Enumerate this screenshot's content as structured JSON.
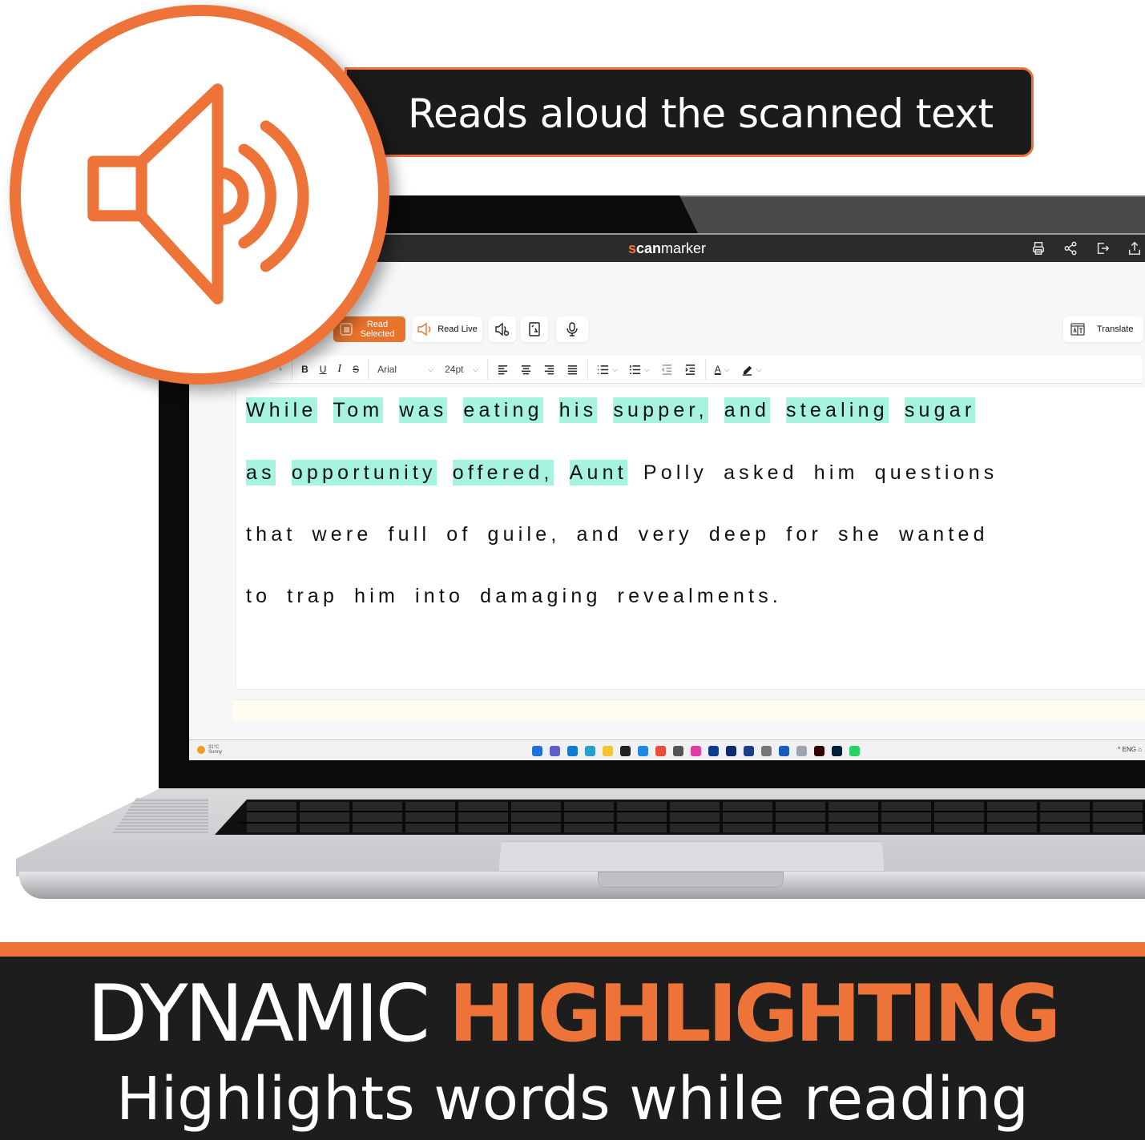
{
  "banner": {
    "text": "Reads aloud the scanned text"
  },
  "app": {
    "brand_s": "s",
    "brand_can": "can",
    "brand_rest": "marker",
    "title_icons": [
      "printer-icon",
      "share-icon",
      "export-icon",
      "upload-icon"
    ]
  },
  "toolbar": {
    "read_selected_line1": "Read",
    "read_selected_line2": "Selected",
    "read_live": "Read Live",
    "translate": "Translate"
  },
  "format_bar": {
    "font": "Arial",
    "size": "24pt",
    "buttons": [
      "bold",
      "underline",
      "italic",
      "strikethrough",
      "align-left",
      "align-center",
      "align-right",
      "justify",
      "bullet-list",
      "numbered-list",
      "outdent",
      "indent",
      "text-color",
      "highlight-color"
    ]
  },
  "document": {
    "lines": [
      [
        {
          "text": "While",
          "highlighted": true
        },
        {
          "text": "Tom",
          "highlighted": true
        },
        {
          "text": "was",
          "highlighted": true
        },
        {
          "text": "eating",
          "highlighted": true
        },
        {
          "text": "his",
          "highlighted": true
        },
        {
          "text": "supper,",
          "highlighted": true
        },
        {
          "text": "and",
          "highlighted": true
        },
        {
          "text": "stealing",
          "highlighted": true
        },
        {
          "text": "sugar",
          "highlighted": true
        }
      ],
      [
        {
          "text": "as",
          "highlighted": true
        },
        {
          "text": "opportunity",
          "highlighted": true
        },
        {
          "text": "offered,",
          "highlighted": true
        },
        {
          "text": "Aunt",
          "highlighted": true
        },
        {
          "text": "Polly",
          "highlighted": false
        },
        {
          "text": "asked",
          "highlighted": false
        },
        {
          "text": "him",
          "highlighted": false
        },
        {
          "text": "questions",
          "highlighted": false
        }
      ],
      [
        {
          "text": "that",
          "highlighted": false
        },
        {
          "text": "were",
          "highlighted": false
        },
        {
          "text": "full",
          "highlighted": false
        },
        {
          "text": "of",
          "highlighted": false
        },
        {
          "text": "guile,",
          "highlighted": false
        },
        {
          "text": "and",
          "highlighted": false
        },
        {
          "text": "very",
          "highlighted": false
        },
        {
          "text": "deep",
          "highlighted": false
        },
        {
          "text": "for",
          "highlighted": false
        },
        {
          "text": "she",
          "highlighted": false
        },
        {
          "text": "wanted",
          "highlighted": false
        }
      ],
      [
        {
          "text": "to",
          "highlighted": false
        },
        {
          "text": "trap",
          "highlighted": false
        },
        {
          "text": "him",
          "highlighted": false
        },
        {
          "text": "into",
          "highlighted": false
        },
        {
          "text": "damaging",
          "highlighted": false
        },
        {
          "text": "revealments.",
          "highlighted": false
        }
      ]
    ],
    "highlight_color": "#a6f3df"
  },
  "taskbar": {
    "weather_temp": "31°C",
    "weather_desc": "Sunny",
    "tray": "^  ENG  ⌂",
    "app_colors": [
      "#1e6fd9",
      "#5b5fc7",
      "#0f7bd4",
      "#2aa0c9",
      "#f2c532",
      "#222222",
      "#1e88e5",
      "#e84d3d",
      "#555555",
      "#e53aa3",
      "#0a3d91",
      "#0d2a6b",
      "#1a3e8c",
      "#777777",
      "#185abd",
      "#9aa5b1",
      "#330000",
      "#001e36",
      "#25d366"
    ]
  },
  "headline": {
    "white": "DYNAMIC",
    "orange": "HIGHLIGHTING"
  },
  "subheadline": "Highlights words while reading",
  "colors": {
    "accent": "#ee7338",
    "dark": "#1d1d1d",
    "highlight": "#a6f3df"
  }
}
